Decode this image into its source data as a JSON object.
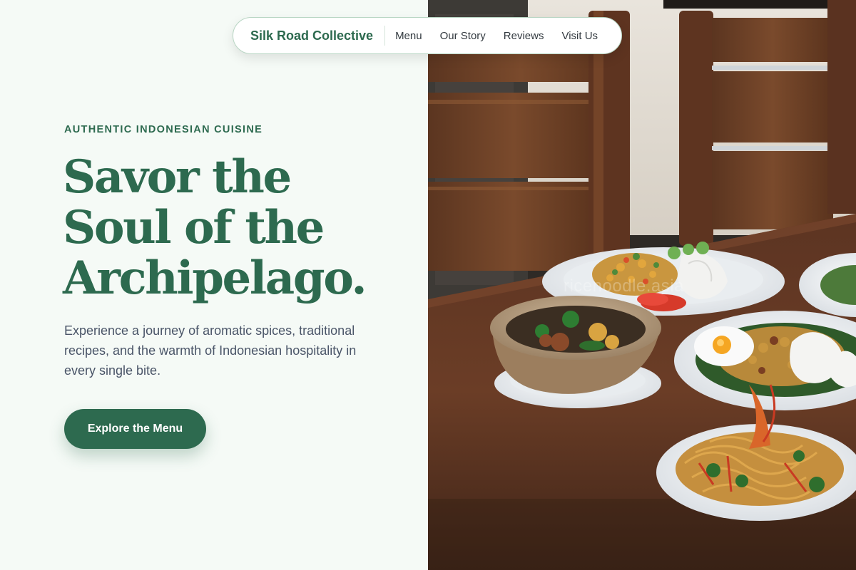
{
  "nav": {
    "brand": "Silk Road Collective",
    "links": [
      "Menu",
      "Our Story",
      "Reviews",
      "Visit Us"
    ]
  },
  "hero": {
    "eyebrow": "AUTHENTIC INDONESIAN CUISINE",
    "headline_lines": [
      "Savor the",
      "Soul of the",
      "Archipelago."
    ],
    "description": "Experience a journey of aromatic spices, traditional recipes, and the warmth of Indonesian hospitality in every single bite.",
    "cta_label": "Explore the Menu"
  },
  "photo": {
    "watermark": "ricenoodle.asia"
  },
  "colors": {
    "accent": "#2d6a4f",
    "background": "#f5faf6",
    "body_text": "#4a5568"
  }
}
